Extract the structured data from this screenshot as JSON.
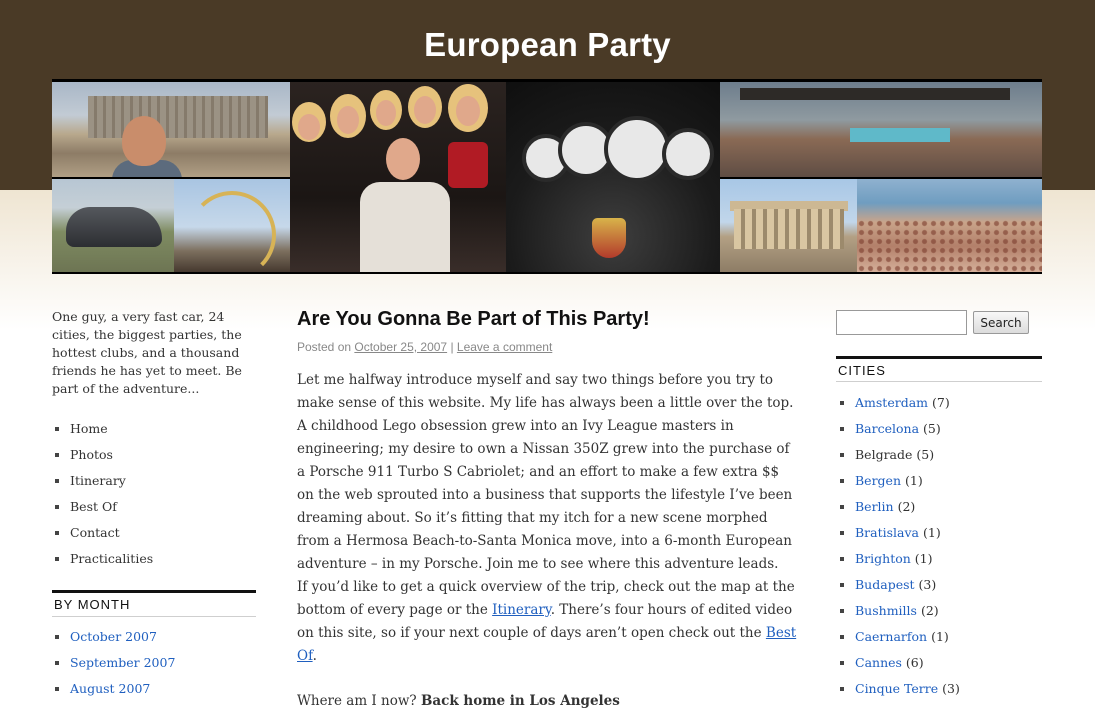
{
  "site": {
    "title": "European Party"
  },
  "sidebar_left": {
    "tagline": "One guy, a very fast car, 24 cities, the biggest parties, the hottest clubs, and a thousand friends he has yet to meet. Be part of the adventure...",
    "nav": [
      "Home",
      "Photos",
      "Itinerary",
      "Best Of",
      "Contact",
      "Practicalities"
    ],
    "by_month_heading": "BY MONTH",
    "months": [
      "October 2007",
      "September 2007",
      "August 2007"
    ]
  },
  "post": {
    "title": "Are You Gonna Be Part of This Party!",
    "meta_prefix": "Posted on ",
    "meta_date": "October 25, 2007",
    "meta_sep": " | ",
    "meta_comment": "Leave a comment",
    "p1": "Let me halfway introduce myself and say two things before you try to make sense of this website. My life has always been a little over the top. A childhood Lego obsession grew into an Ivy League masters in engineering; my desire to own a Nissan 350Z grew into the purchase of a Porsche 911 Turbo S Cabriolet; and an effort to make a few extra $$ on the web sprouted into a business that supports the lifestyle I’ve been dreaming about. So it’s fitting that my itch for a new scene morphed from a Hermosa Beach-to-Santa Monica move, into a 6-month European adventure – in my Porsche. Join me to see where this adventure leads.",
    "p2_a": "If you’d like to get a quick overview of the trip, check out the map at the bottom of every page or the ",
    "p2_link1": "Itinerary",
    "p2_b": ". There’s four hours of edited video on this site, so if your next couple of days aren’t open check out the ",
    "p2_link2": "Best Of",
    "p2_c": ".",
    "now_label": "Where am I now? ",
    "now_value": "Back home in Los Angeles"
  },
  "sidebar_right": {
    "search_button": "Search",
    "cities_heading": "CITIES",
    "cities": [
      {
        "name": "Amsterdam",
        "count": "(7)",
        "link": true
      },
      {
        "name": "Barcelona",
        "count": "(5)",
        "link": true
      },
      {
        "name": "Belgrade",
        "count": "(5)",
        "link": false
      },
      {
        "name": "Bergen",
        "count": "(1)",
        "link": true
      },
      {
        "name": "Berlin",
        "count": "(2)",
        "link": true
      },
      {
        "name": "Bratislava",
        "count": "(1)",
        "link": true
      },
      {
        "name": "Brighton",
        "count": "(1)",
        "link": true
      },
      {
        "name": "Budapest",
        "count": "(3)",
        "link": true
      },
      {
        "name": "Bushmills",
        "count": "(2)",
        "link": true
      },
      {
        "name": "Caernarfon",
        "count": "(1)",
        "link": true
      },
      {
        "name": "Cannes",
        "count": "(6)",
        "link": true
      },
      {
        "name": "Cinque Terre",
        "count": "(3)",
        "link": true
      }
    ]
  },
  "colors": {
    "header_bg": "#4a3a26",
    "link": "#1f5fbf"
  }
}
